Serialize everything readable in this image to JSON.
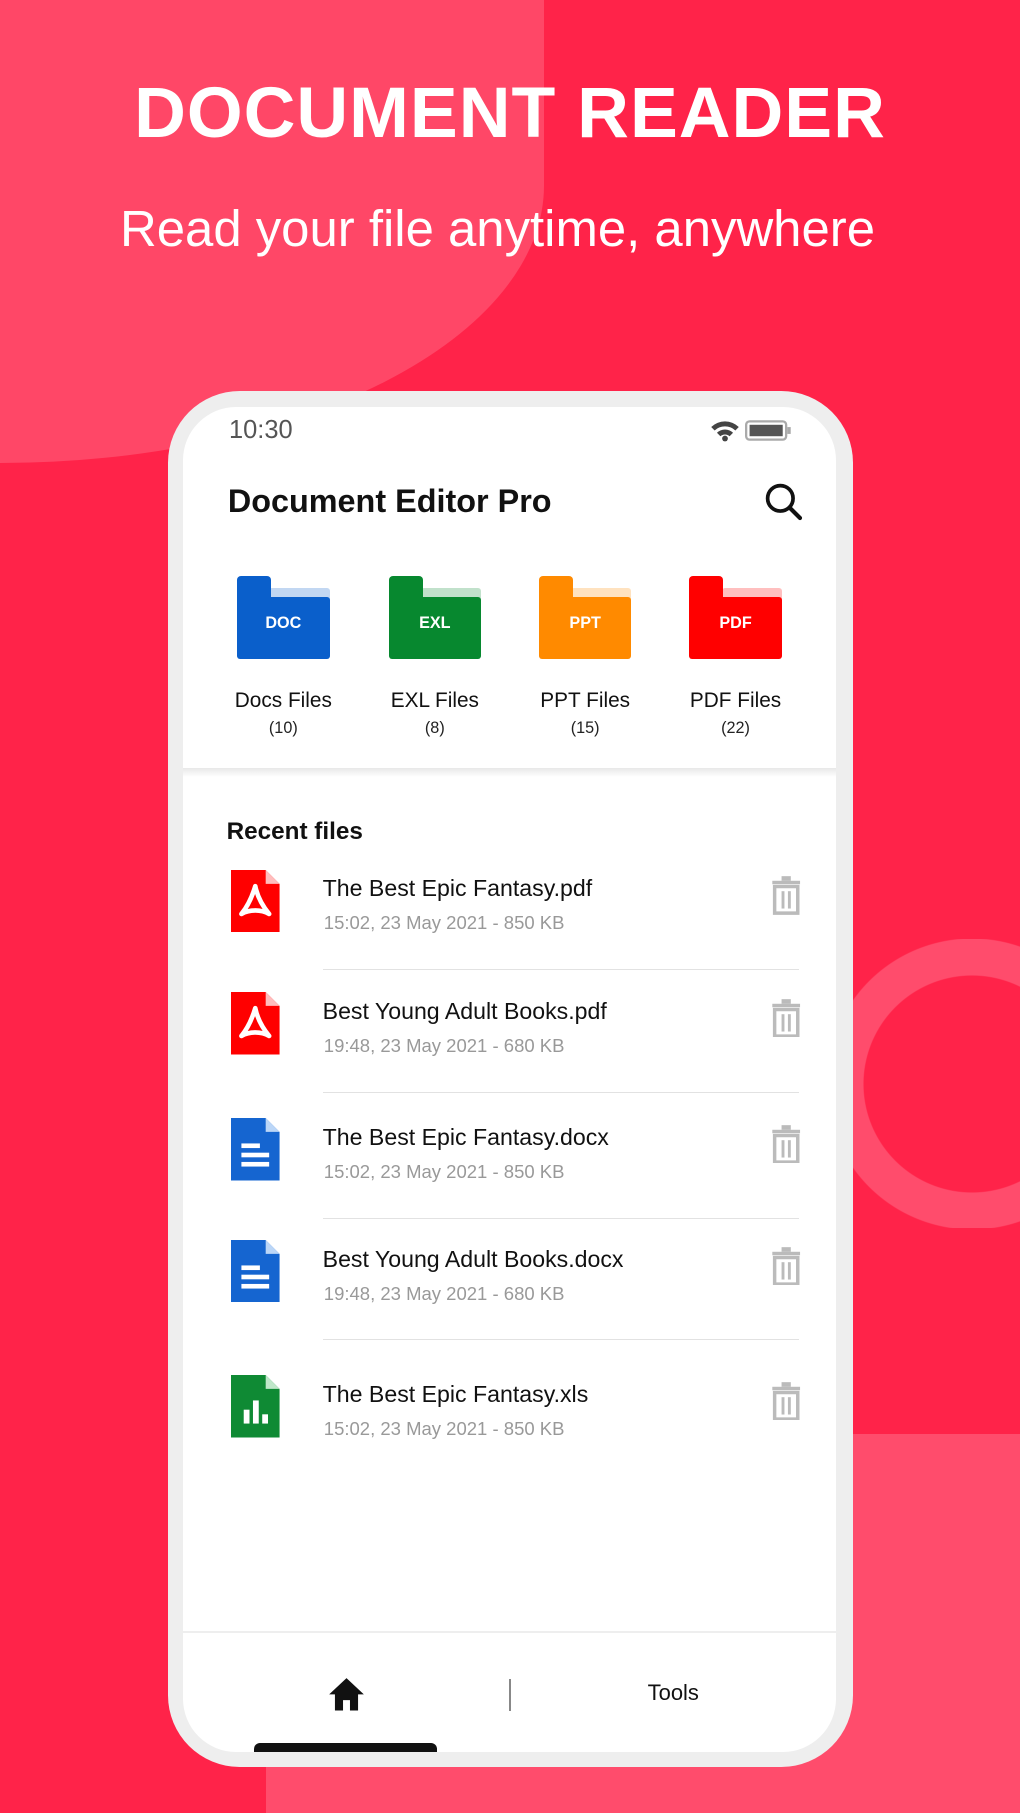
{
  "promo": {
    "headline": "DOCUMENT READER",
    "subheadline": "Read your file anytime, anywhere"
  },
  "status_bar": {
    "time": "10:30"
  },
  "app": {
    "title": "Document Editor Pro"
  },
  "categories": [
    {
      "label": "Docs Files",
      "count": "(10)",
      "badge": "DOC",
      "color": "#0A5FCB"
    },
    {
      "label": "EXL Files",
      "count": "(8)",
      "badge": "EXL",
      "color": "#07882F"
    },
    {
      "label": "PPT Files",
      "count": "(15)",
      "badge": "PPT",
      "color": "#FF8A00"
    },
    {
      "label": "PDF Files",
      "count": "(22)",
      "badge": "PDF",
      "color": "#FF0000"
    }
  ],
  "recent": {
    "heading": "Recent files",
    "files": [
      {
        "name": "The Best Epic Fantasy.pdf",
        "meta": "15:02, 23 May 2021 - 850 KB",
        "type": "pdf"
      },
      {
        "name": "Best Young Adult Books.pdf",
        "meta": "19:48, 23 May 2021 - 680 KB",
        "type": "pdf"
      },
      {
        "name": "The Best Epic Fantasy.docx",
        "meta": "15:02, 23 May 2021 - 850 KB",
        "type": "doc"
      },
      {
        "name": "Best Young Adult Books.docx",
        "meta": "19:48, 23 May 2021 - 680 KB",
        "type": "doc"
      },
      {
        "name": "The Best Epic Fantasy.xls",
        "meta": "15:02, 23 May 2021 - 850 KB",
        "type": "xls"
      }
    ]
  },
  "nav": {
    "tools_label": "Tools"
  }
}
